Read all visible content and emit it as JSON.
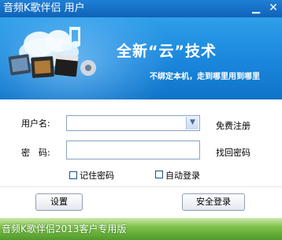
{
  "window": {
    "title": "音频K歌伴侣 用户",
    "minimize_glyph": "▁",
    "close_glyph": "✕"
  },
  "banner": {
    "slogan": "全新“云”技术",
    "subtitle": "不绑定本机，走到哪里用到哪里"
  },
  "form": {
    "username_label": "用户名:",
    "username_value": "",
    "password_label": "密　码:",
    "password_value": "",
    "register_link": "免费注册",
    "forgot_link": "找回密码",
    "remember_label": "记住密码",
    "remember_checked": false,
    "auto_login_label": "自动登录",
    "auto_login_checked": false,
    "dropdown_icon": "chevron-down-icon"
  },
  "buttons": {
    "settings": "设置",
    "login": "安全登录"
  },
  "footer": {
    "text": "音频K歌伴侣2013客户专用版"
  },
  "colors": {
    "title_bar": "#1570c8",
    "banner": "#1f8fe0",
    "footer_grass": "#6ab23a"
  }
}
